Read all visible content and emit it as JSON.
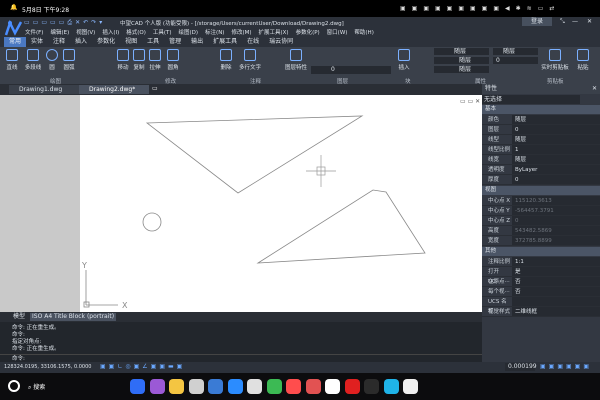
{
  "system": {
    "datetime": "5月8日 下午9:28"
  },
  "title": {
    "text": "中望CAD 个人版 (功能受限) - [/storage/Users/currentUser/Download/Drawing2.dwg]",
    "login": "登录"
  },
  "menu": [
    "文件(F)",
    "编辑(E)",
    "视图(V)",
    "插入(I)",
    "格式(O)",
    "工具(T)",
    "绘图(D)",
    "标注(N)",
    "修改(M)",
    "扩展工具(X)",
    "参数化(P)",
    "窗口(W)",
    "帮助(H)"
  ],
  "ribbon_tabs": [
    "常用",
    "实体",
    "注释",
    "插入",
    "参数化",
    "视图",
    "工具",
    "管理",
    "输出",
    "扩展工具",
    "在线",
    "瑞云协同"
  ],
  "tools": {
    "line": "直线",
    "polyline": "多段线",
    "circle": "圆",
    "arc": "圆弧",
    "move": "移动",
    "copy": "复制",
    "stretch": "拉伸",
    "fillet": "圆角",
    "erase": "删除",
    "mtext": "多行文字",
    "layer_props": "图层特性",
    "insert": "插入",
    "clipboard": "实时剪贴板",
    "paste": "粘贴"
  },
  "groups": {
    "draw": "绘图",
    "modify": "修改",
    "annotate": "注释",
    "layers": "图层",
    "block": "块",
    "properties": "属性",
    "clipboard": "剪贴板"
  },
  "layer_current": "0",
  "prop_dropdowns": {
    "color": "随层",
    "linetype": "随层",
    "lineweight": "随层",
    "layer2": "随层",
    "value": "0"
  },
  "doc_tabs": [
    "Drawing1.dwg",
    "Drawing2.dwg*"
  ],
  "layout_tabs": [
    "模型",
    "ISO A4 Title Block (portrait)"
  ],
  "ucs": {
    "x": "X",
    "y": "Y"
  },
  "properties": {
    "title": "特性",
    "selection": "无选择",
    "basic": {
      "label": "基本",
      "rows": [
        [
          "颜色",
          "随层"
        ],
        [
          "图层",
          "0"
        ],
        [
          "线型",
          "随层"
        ],
        [
          "线型比例",
          "1"
        ],
        [
          "线宽",
          "随层"
        ],
        [
          "透明度",
          "ByLayer"
        ],
        [
          "厚度",
          "0"
        ]
      ]
    },
    "view": {
      "label": "视图",
      "rows": [
        [
          "中心点 X",
          "115120.3613"
        ],
        [
          "中心点 Y",
          "-564457.3791"
        ],
        [
          "中心点 Z",
          "0"
        ],
        [
          "高度",
          "543482.5869"
        ],
        [
          "宽度",
          "372785.8899"
        ]
      ]
    },
    "other": {
      "label": "其他",
      "rows": [
        [
          "注释比例",
          "1:1"
        ],
        [
          "打开 UC···",
          "是"
        ],
        [
          "在原点···",
          "否"
        ],
        [
          "每个视···",
          "否"
        ],
        [
          "UCS 名称",
          ""
        ],
        [
          "视觉样式",
          "二维线框"
        ]
      ]
    }
  },
  "command": {
    "history": [
      "命令: 正在重生成。",
      "命令:",
      "指定对角点:",
      "命令: 正在重生成。"
    ],
    "prompt": "命令:"
  },
  "status": {
    "coords": "128324.0195, 33106.1575, 0.0000",
    "scale": "0.000199"
  },
  "dock": {
    "search": "搜索"
  }
}
